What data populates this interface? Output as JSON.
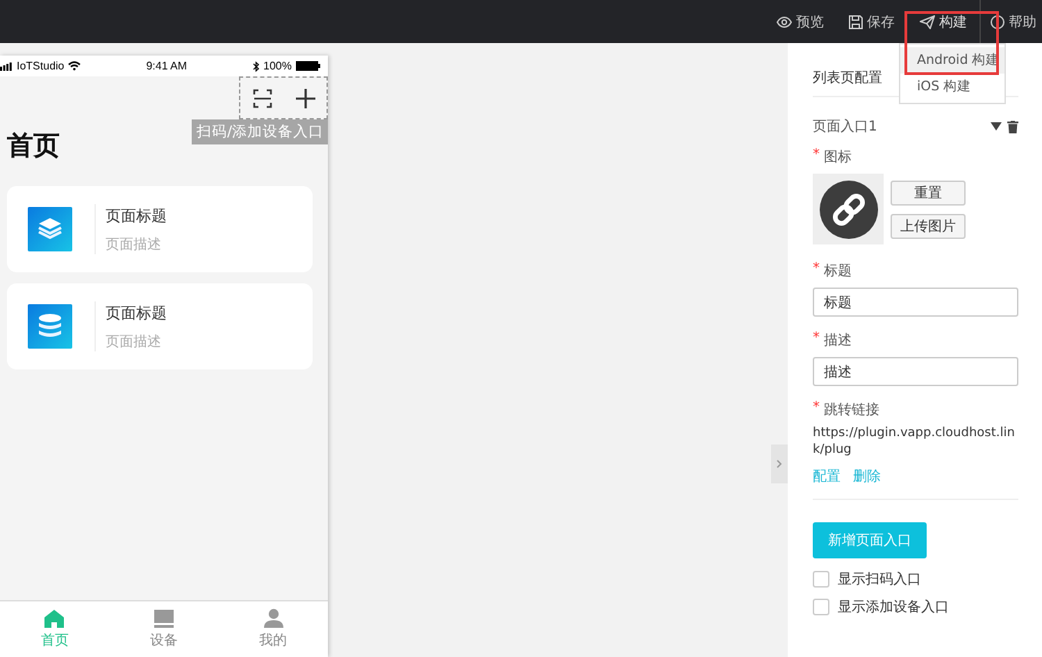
{
  "toolbar": {
    "actions": [
      {
        "label": "预览",
        "kind": "preview",
        "highlighted": false
      },
      {
        "label": "保存",
        "kind": "save",
        "highlighted": false
      },
      {
        "label": "构建",
        "kind": "build",
        "highlighted": true
      },
      {
        "label": "帮助",
        "kind": "help",
        "highlighted": false
      }
    ]
  },
  "build_menu": {
    "items": [
      {
        "label": "Android 构建",
        "selected": true
      },
      {
        "label": "iOS 构建",
        "selected": false
      }
    ]
  },
  "phone": {
    "status_bar": {
      "carrier": "IoTStudio",
      "time": "9:41 AM",
      "battery": "100%"
    },
    "entry_label": "扫码/添加设备入口",
    "title": "首页",
    "cards": [
      {
        "title": "页面标题",
        "description": "页面描述",
        "kind": "layers"
      },
      {
        "title": "页面标题",
        "description": "页面描述",
        "kind": "database"
      }
    ],
    "tab_bar": [
      {
        "label": "首页",
        "kind": "home",
        "selected": true
      },
      {
        "label": "设备",
        "kind": "device",
        "selected": false
      },
      {
        "label": "我的",
        "kind": "user",
        "selected": false
      }
    ]
  },
  "panel": {
    "section_title": "列表页配置",
    "entry_title": "页面入口1",
    "icon_field": {
      "mark": "*",
      "label": "图标",
      "reset_button": "重置",
      "upload_button": "上传图片"
    },
    "fields": [
      {
        "mark": "*",
        "label": "标题",
        "value": "标题"
      },
      {
        "mark": "*",
        "label": "描述",
        "value": "描述"
      }
    ],
    "link": {
      "mark": "*",
      "label": "跳转链接",
      "value": "https://plugin.vapp.cloudhost.link/plug",
      "actions": [
        "配置",
        "删除"
      ]
    },
    "add_button": "新增页面入口",
    "options": [
      {
        "label": "显示扫码入口",
        "checked": false
      },
      {
        "label": "显示添加设备入口",
        "checked": false
      }
    ]
  }
}
